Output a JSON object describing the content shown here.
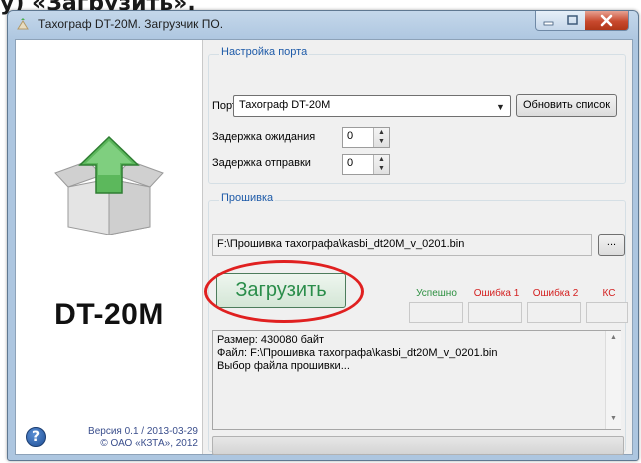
{
  "caption": "у) «Загрузить».",
  "window": {
    "title": "Тахограф DT-20M. Загрузчик ПО.",
    "minimize_icon": "minimize-icon",
    "maximize_icon": "maximize-icon",
    "close_icon": "close-icon"
  },
  "left_panel": {
    "device": "DT-20M",
    "help_glyph": "?",
    "version": "Версия 0.1 / 2013-03-29",
    "copyright": "© ОАО «КЗТА», 2012"
  },
  "port_settings": {
    "title": "Настройка порта",
    "port_label": "Порт",
    "port_value": "Тахограф DT-20M",
    "refresh_label": "Обновить список",
    "wait_label": "Задержка ожидания",
    "wait_value": "0",
    "send_label": "Задержка отправки",
    "send_value": "0"
  },
  "firmware": {
    "title": "Прошивка",
    "file_path": "F:\\Прошивка тахографа\\kasbi_dt20M_v_0201.bin",
    "browse_label": "...",
    "upload_label": "Загрузить",
    "status": {
      "success": "Успешно",
      "error1": "Ошибка 1",
      "error2": "Ошибка 2",
      "cs": "КС"
    },
    "log": [
      "Размер: 430080 байт",
      "Файл: F:\\Прошивка тахографа\\kasbi_dt20M_v_0201.bin",
      "Выбор файла прошивки..."
    ],
    "progress": 0
  },
  "colors": {
    "group_title": "#1d5aa8",
    "success": "#2b8f3f",
    "error": "#d42020",
    "upload_text": "#2a8d4a",
    "highlight_circle": "#e02020"
  }
}
